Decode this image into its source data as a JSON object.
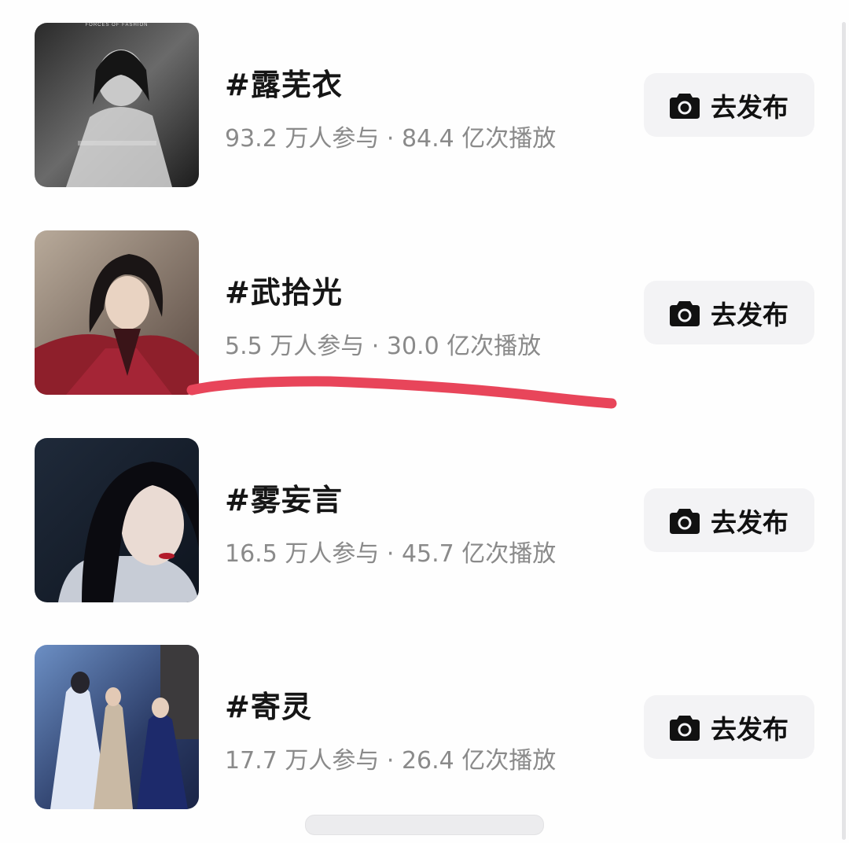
{
  "topics": [
    {
      "title": "#露芜衣",
      "stats": "93.2 万人参与 · 84.4 亿次播放",
      "publish_label": "去发布",
      "thumb_caption": "FORCES OF FASHION"
    },
    {
      "title": "#武拾光",
      "stats": "5.5 万人参与 · 30.0 亿次播放",
      "publish_label": "去发布"
    },
    {
      "title": "#雾妄言",
      "stats": "16.5 万人参与 · 45.7 亿次播放",
      "publish_label": "去发布"
    },
    {
      "title": "#寄灵",
      "stats": "17.7 万人参与 · 26.4 亿次播放",
      "publish_label": "去发布"
    }
  ],
  "icons": {
    "publish": "camera-icon"
  },
  "colors": {
    "title": "#161616",
    "stats": "#8a8a8a",
    "button_bg": "#f3f3f5",
    "annotation_underline": "#e8455a"
  }
}
